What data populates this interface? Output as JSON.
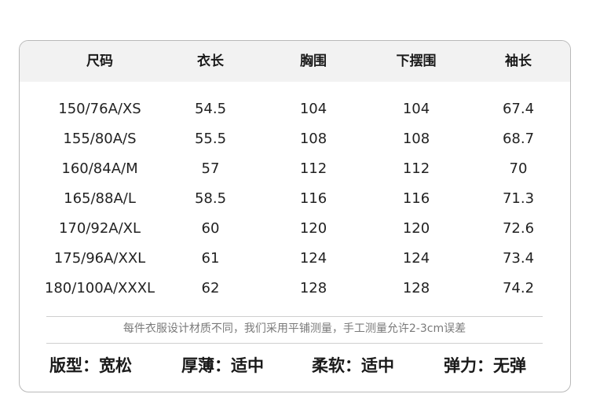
{
  "table": {
    "headers": [
      "尺码",
      "衣长",
      "胸围",
      "下摆围",
      "袖长"
    ],
    "rows": [
      [
        "150/76A/XS",
        "54.5",
        "104",
        "104",
        "67.4"
      ],
      [
        "155/80A/S",
        "55.5",
        "108",
        "108",
        "68.7"
      ],
      [
        "160/84A/M",
        "57",
        "112",
        "112",
        "70"
      ],
      [
        "165/88A/L",
        "58.5",
        "116",
        "116",
        "71.3"
      ],
      [
        "170/92A/XL",
        "60",
        "120",
        "120",
        "72.6"
      ],
      [
        "175/96A/XXL",
        "61",
        "124",
        "124",
        "73.4"
      ],
      [
        "180/100A/XXXL",
        "62",
        "128",
        "128",
        "74.2"
      ]
    ]
  },
  "note": "每件衣服设计材质不同，我们采用平铺测量，手工测量允许2-3cm误差",
  "attributes": [
    "版型：宽松",
    "厚薄：适中",
    "柔软：适中",
    "弹力：无弹"
  ]
}
